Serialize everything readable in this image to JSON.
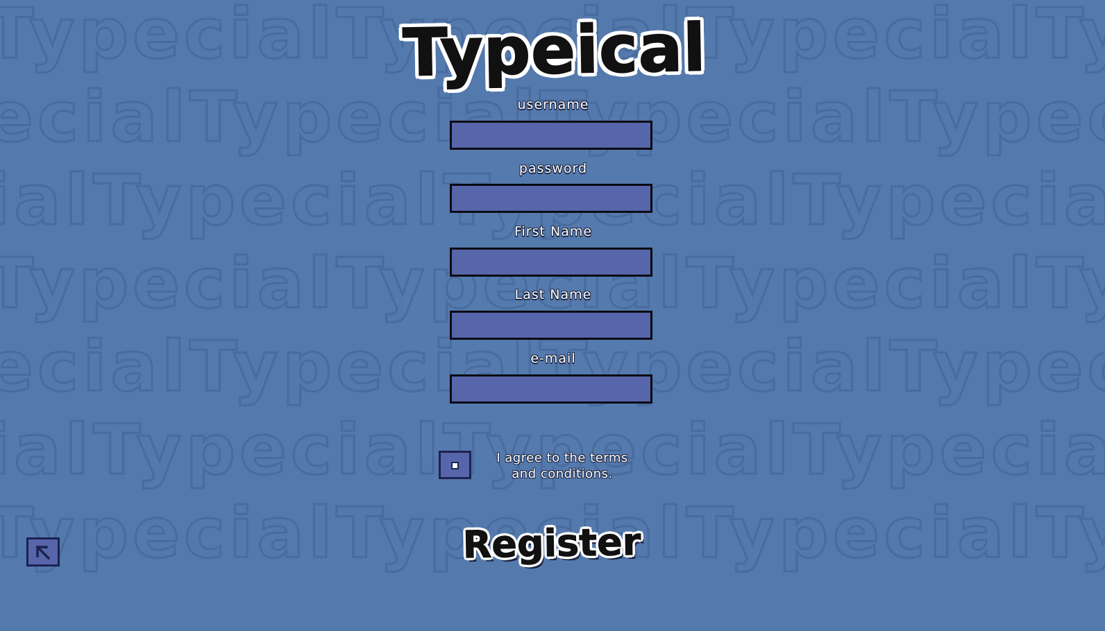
{
  "app": {
    "logo_text": "Typeical",
    "background_color": "#5479ac",
    "input_fill_color": "#5766ab"
  },
  "form": {
    "fields": [
      {
        "label": "username",
        "value": ""
      },
      {
        "label": "password",
        "value": ""
      },
      {
        "label": "First Name",
        "value": ""
      },
      {
        "label": "Last Name",
        "value": ""
      },
      {
        "label": "e-mail",
        "value": ""
      }
    ],
    "terms": {
      "line1": "I agree to the terms",
      "line2": "and conditions.",
      "checked": false
    },
    "register_label": "Register"
  },
  "navigation": {
    "back_icon": "arrow-up-left-icon"
  },
  "background": {
    "watermark_text": "Typecial"
  }
}
